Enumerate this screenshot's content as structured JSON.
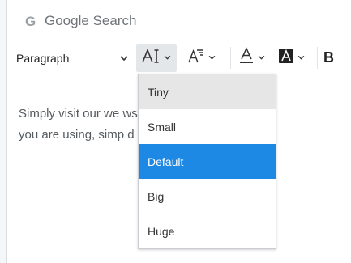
{
  "search": {
    "g_icon": "G",
    "label": "Google Search"
  },
  "toolbar": {
    "paragraph_label": "Paragraph",
    "font_size_icon": "AI",
    "font_family_icon": "AF",
    "font_color_icon": "A",
    "bg_color_icon": "A",
    "bold_label": "B"
  },
  "content": {
    "line1": "Simply visit our we                              wser of you",
    "line2": "you are using, simp                            d start usi"
  },
  "font_size_menu": {
    "items": [
      {
        "label": "Tiny"
      },
      {
        "label": "Small"
      },
      {
        "label": "Default"
      },
      {
        "label": "Big"
      },
      {
        "label": "Huge"
      }
    ],
    "selected": "Default",
    "hovered": "Tiny"
  },
  "colors": {
    "accent": "#1e88e5",
    "hover": "#e6e6e6",
    "text": "#555a5f"
  }
}
